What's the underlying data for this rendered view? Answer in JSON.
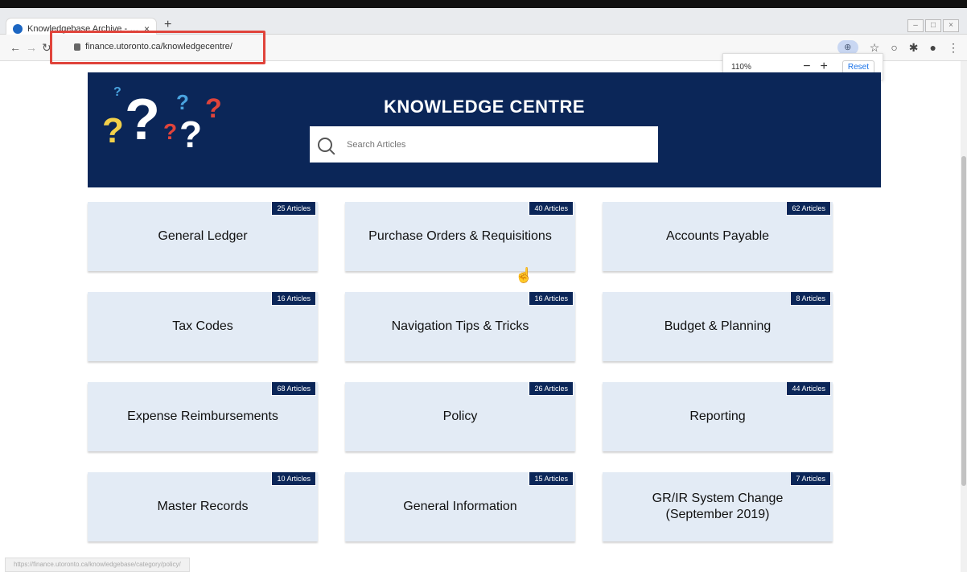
{
  "browser": {
    "tab_title": "Knowledgebase Archive - Finan",
    "tab_close": "×",
    "new_tab": "+",
    "url": "finance.utoronto.ca/knowledgecentre/",
    "zoom_percent": "110%",
    "zoom_minus": "−",
    "zoom_plus": "+",
    "zoom_reset": "Reset",
    "status_text": "https://finance.utoronto.ca/knowledgebase/category/policy/"
  },
  "banner": {
    "title": "KNOWLEDGE CENTRE",
    "search_placeholder": "Search Articles"
  },
  "cards": [
    {
      "label": "General Ledger",
      "badge": "25 Articles"
    },
    {
      "label": "Purchase Orders & Requisitions",
      "badge": "40 Articles"
    },
    {
      "label": "Accounts Payable",
      "badge": "62 Articles"
    },
    {
      "label": "Tax Codes",
      "badge": "16 Articles"
    },
    {
      "label": "Navigation Tips & Tricks",
      "badge": "16 Articles"
    },
    {
      "label": "Budget & Planning",
      "badge": "8 Articles"
    },
    {
      "label": "Expense Reimbursements",
      "badge": "68 Articles"
    },
    {
      "label": "Policy",
      "badge": "26 Articles"
    },
    {
      "label": "Reporting",
      "badge": "44 Articles"
    },
    {
      "label": "Master Records",
      "badge": "10 Articles"
    },
    {
      "label": "General Information",
      "badge": "15 Articles"
    },
    {
      "label": "GR/IR System Change (September 2019)",
      "badge": "7 Articles"
    }
  ]
}
